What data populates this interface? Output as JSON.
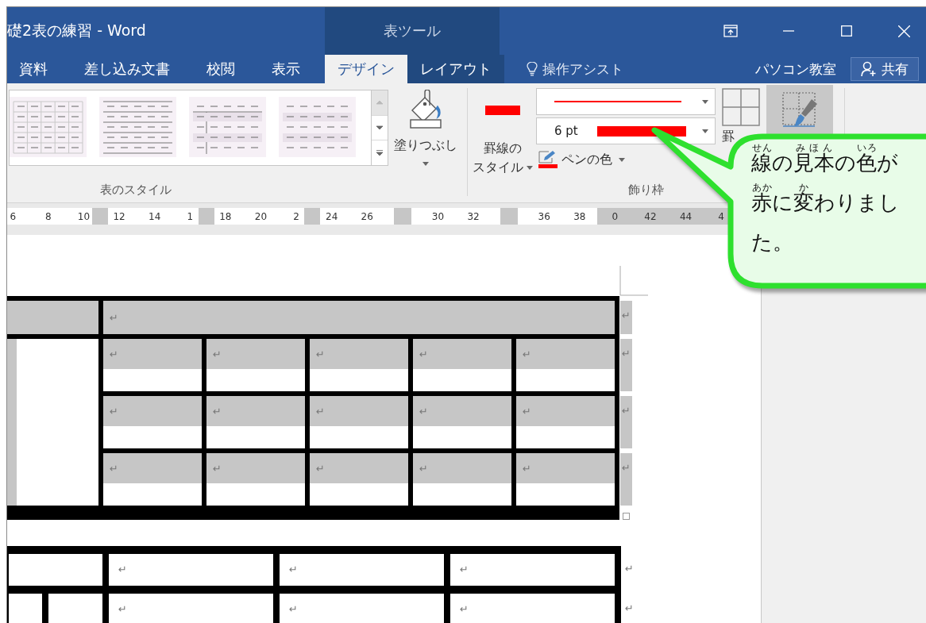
{
  "window": {
    "title": "礎2表の練習 - Word",
    "context_title": "表ツール",
    "controls": [
      {
        "kind": "ribbon-display"
      },
      {
        "kind": "minimize"
      },
      {
        "kind": "maximize"
      },
      {
        "kind": "close"
      }
    ]
  },
  "tabs": [
    {
      "label": "資料",
      "selected": false,
      "context": false
    },
    {
      "label": "差し込み文書",
      "selected": false,
      "context": false
    },
    {
      "label": "校閲",
      "selected": false,
      "context": false
    },
    {
      "label": "表示",
      "selected": false,
      "context": false
    },
    {
      "label": "デザイン",
      "selected": true,
      "context": true
    },
    {
      "label": "レイアウト",
      "selected": false,
      "context": true
    }
  ],
  "tell_me": {
    "label": "操作アシスト"
  },
  "account": {
    "name": "パソコン教室"
  },
  "share": {
    "label": "共有"
  },
  "table_styles": {
    "label": "表のスタイル",
    "styles": [
      {
        "kind": "grid"
      },
      {
        "kind": "rules"
      },
      {
        "kind": "first-column"
      },
      {
        "kind": "banded"
      }
    ],
    "scroll_buttons": [
      {
        "kind": "up",
        "disabled": true
      },
      {
        "kind": "down",
        "disabled": false
      },
      {
        "kind": "more",
        "disabled": false
      }
    ]
  },
  "shading": {
    "label": "塗りつぶし"
  },
  "borders": {
    "label": "飾り枠",
    "style_button": {
      "label_lines": [
        "罫線の",
        "スタイル"
      ]
    },
    "line_weight": {
      "value": "6 pt"
    },
    "pen_color_button": {
      "label": "ペンの色"
    },
    "borders_button": {
      "label": "罫"
    },
    "border_painter": {
      "selected": true
    }
  },
  "ruler": {
    "items": [
      {
        "kind": "num",
        "label": "6",
        "margin": false
      },
      {
        "kind": "num",
        "label": "8",
        "margin": false
      },
      {
        "kind": "num",
        "label": "10",
        "margin": false
      },
      {
        "kind": "marker"
      },
      {
        "kind": "num",
        "label": "12",
        "margin": false
      },
      {
        "kind": "num",
        "label": "14",
        "margin": false
      },
      {
        "kind": "num",
        "label": "1",
        "margin": false
      },
      {
        "kind": "marker"
      },
      {
        "kind": "num",
        "label": "18",
        "margin": false
      },
      {
        "kind": "num",
        "label": "20",
        "margin": false
      },
      {
        "kind": "num",
        "label": "2",
        "margin": false
      },
      {
        "kind": "marker"
      },
      {
        "kind": "num",
        "label": "24",
        "margin": false
      },
      {
        "kind": "num",
        "label": "26",
        "margin": false
      },
      {
        "kind": "stop"
      },
      {
        "kind": "num",
        "label": "30",
        "margin": false
      },
      {
        "kind": "num",
        "label": "32",
        "margin": false
      },
      {
        "kind": "stop"
      },
      {
        "kind": "num",
        "label": "36",
        "margin": false
      },
      {
        "kind": "num",
        "label": "38",
        "margin": false
      },
      {
        "kind": "num",
        "label": "0",
        "margin": true
      },
      {
        "kind": "num",
        "label": "42",
        "margin": true
      },
      {
        "kind": "num",
        "label": "44",
        "margin": true
      },
      {
        "kind": "num",
        "label": "4",
        "margin": true
      }
    ]
  },
  "tables": [
    {
      "kind": "merged",
      "selected": true,
      "rows": [
        {
          "cells": [
            "↵"
          ],
          "end_mark": "↵"
        },
        {
          "cells": [
            "↵",
            "↵",
            "↵",
            "↵",
            "↵"
          ],
          "end_mark": "↵"
        },
        {
          "cells": [
            "↵",
            "↵",
            "↵",
            "↵",
            "↵"
          ],
          "end_mark": "↵"
        },
        {
          "cells": [
            "↵",
            "↵",
            "↵",
            "↵",
            "↵"
          ],
          "end_mark": "↵"
        }
      ]
    },
    {
      "kind": "split",
      "selected": false,
      "rows": [
        {
          "cells": [
            "↵",
            "↵",
            "↵"
          ],
          "end_mark": "↵"
        },
        {
          "cells": [
            "↵",
            "↵",
            "↵"
          ],
          "end_mark": "↵"
        }
      ]
    }
  ],
  "callout": {
    "segments": [
      {
        "text": "線",
        "ruby": "せん"
      },
      {
        "text": "の"
      },
      {
        "text": "見本",
        "ruby": "みほん"
      },
      {
        "text": "の"
      },
      {
        "text": "色",
        "ruby": "いろ"
      },
      {
        "text": "が"
      },
      {
        "text": "赤",
        "ruby": "あか"
      },
      {
        "text": "に"
      },
      {
        "text": "変",
        "ruby": "か"
      },
      {
        "text": "わりました。"
      }
    ]
  }
}
